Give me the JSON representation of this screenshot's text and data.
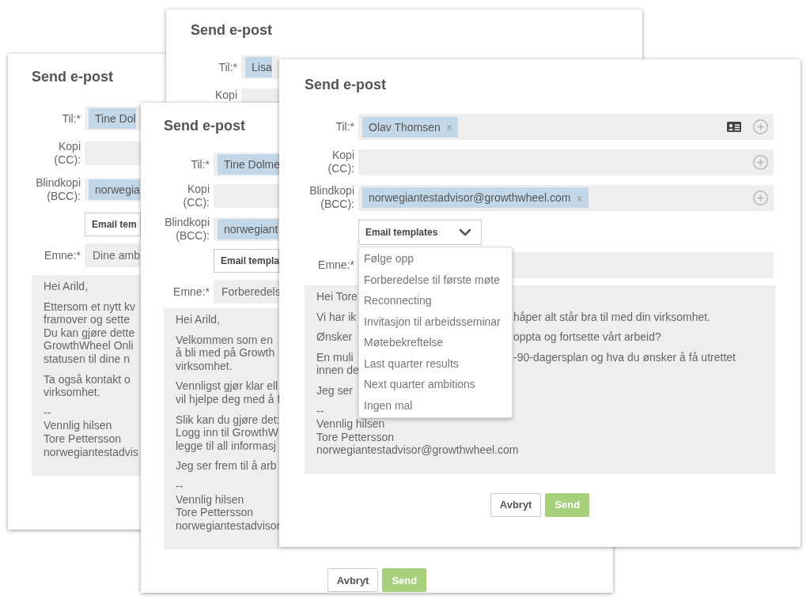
{
  "windows": [
    {
      "title": "Send e-post",
      "fields": [
        {
          "label": "Til:*",
          "chips": [
            {
              "text": "Tine Dol"
            }
          ]
        },
        {
          "label": "Kopi (CC):"
        },
        {
          "label": "Blindkopi (BCC):",
          "chips": [
            {
              "text": "norwegia"
            }
          ]
        }
      ],
      "templates": {
        "label": "Email tem"
      },
      "subject": {
        "label": "Emne:*",
        "value": "Dine amb"
      },
      "body": [
        [
          [
            "Hei Arild,"
          ]
        ],
        [
          [
            "Ettersom et nytt kv"
          ],
          [
            "framover og sette"
          ],
          [
            "Du kan gjøre dette"
          ],
          [
            "GrowthWheel Onli"
          ],
          [
            "statusen til dine n"
          ]
        ],
        [
          [
            "Ta også kontakt o"
          ],
          [
            "virksomhet."
          ]
        ],
        [
          [
            "--"
          ],
          [
            "Vennlig hilsen"
          ],
          [
            "Tore Pettersson"
          ],
          [
            "norwegiantestadvis"
          ]
        ]
      ]
    },
    {
      "title": "Send e-post",
      "fields": [
        {
          "label": "Til:*",
          "chips": [
            {
              "text": "Lisa"
            }
          ]
        },
        {
          "label": "Kopi"
        }
      ]
    },
    {
      "title": "Send e-post",
      "fields": [
        {
          "label": "Til:*",
          "chips": [
            {
              "text": "Tine Dolme"
            }
          ]
        },
        {
          "label": "Kopi (CC):"
        },
        {
          "label": "Blindkopi (BCC):",
          "chips": [
            {
              "text": "norwegiant"
            }
          ]
        }
      ],
      "templates": {
        "label": "Email templa"
      },
      "subject": {
        "label": "Emne:*",
        "value": "Forberedels"
      },
      "body": [
        [
          [
            "Hei Arild,"
          ]
        ],
        [
          [
            "Velkommen som en"
          ],
          [
            "å bli med på Growth"
          ],
          [
            "virksomhet."
          ]
        ],
        [
          [
            "Vennligst gjør klar ell"
          ],
          [
            "vil hjelpe deg med å f"
          ]
        ],
        [
          [
            "Slik kan du gjøre det:"
          ],
          [
            "Logg inn til GrowthW"
          ],
          [
            "legge til all informasj"
          ]
        ],
        [
          [
            "Jeg ser frem til å arb"
          ]
        ],
        [
          [
            "--"
          ],
          [
            "Vennlig hilsen"
          ],
          [
            "Tore Pettersson"
          ],
          [
            "norwegiantestadvisor"
          ]
        ]
      ],
      "buttons": [
        {
          "label": "Avbryt",
          "kind": "secondary"
        },
        {
          "label": "Send",
          "kind": "primary"
        }
      ]
    },
    {
      "title": "Send e-post",
      "fields": [
        {
          "label": "Til:*",
          "chips": [
            {
              "text": "Olav Thomsen",
              "remove": "x"
            }
          ],
          "address_book": true,
          "add": true
        },
        {
          "label": "Kopi (CC):",
          "add": true
        },
        {
          "label": "Blindkopi (BCC):",
          "chips": [
            {
              "text": "norwegiantestadvisor@growthwheel.com",
              "remove": "x"
            }
          ],
          "add": true
        }
      ],
      "templates": {
        "label": "Email templates",
        "expanded": true,
        "options": [
          "Følge opp",
          "Forberedelse til første møte",
          "Reconnecting",
          "Invitasjon til arbeidsseminar",
          "Møtebekreftelse",
          "Last quarter results",
          "Next quarter ambitions",
          "Ingen mal"
        ]
      },
      "subject": {
        "label": "Emne:*"
      },
      "body": [
        [
          [
            "Hei Tore"
          ]
        ],
        [
          [
            "Vi har ik",
            "håper alt står bra til med din virksomhet."
          ]
        ],
        [
          [
            "Ønsker",
            "oppta og fortsette vårt arbeid?"
          ]
        ],
        [
          [
            "En muli",
            "-90-dagersplan og hva du ønsker å få utrettet"
          ],
          [
            "innen de"
          ]
        ],
        [
          [
            "Jeg ser"
          ]
        ],
        [
          [
            "--"
          ],
          [
            "Vennlig hilsen"
          ],
          [
            "Tore Pettersson"
          ],
          [
            "norwegiantestadvisor@growthwheel.com"
          ]
        ]
      ],
      "buttons": [
        {
          "label": "Avbryt",
          "kind": "secondary"
        },
        {
          "label": "Send",
          "kind": "primary"
        }
      ]
    }
  ]
}
